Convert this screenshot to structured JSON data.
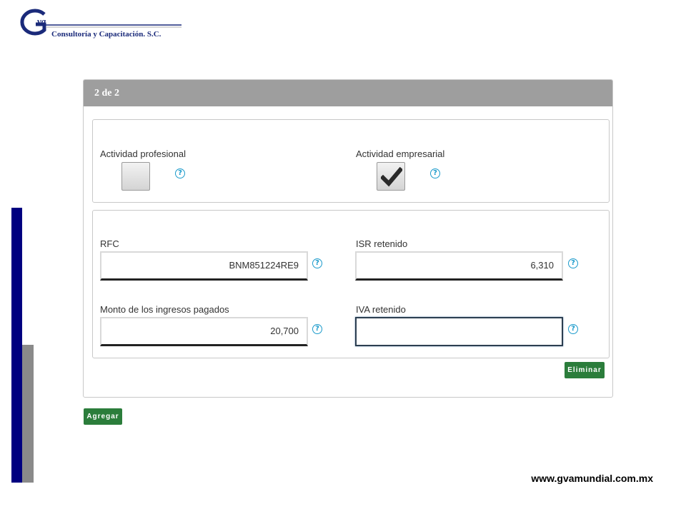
{
  "logo": {
    "monogram": "Gva",
    "company": "Consultoría y Capacitación. S.C."
  },
  "panel": {
    "title": "2 de 2"
  },
  "activity": {
    "profesional": {
      "label": "Actividad profesional",
      "checked": false
    },
    "empresarial": {
      "label": "Actividad empresarial",
      "checked": true
    }
  },
  "fields": {
    "rfc": {
      "label": "RFC",
      "value": "BNM851224RE9"
    },
    "isr": {
      "label": "ISR retenido",
      "value": "6,310"
    },
    "monto": {
      "label": "Monto de los ingresos pagados",
      "value": "20,700"
    },
    "iva": {
      "label": "IVA retenido",
      "value": ""
    }
  },
  "help_glyph": "?",
  "buttons": {
    "eliminar": "Eliminar",
    "agregar": "Agregar"
  },
  "footer": {
    "url": "www.gvamundial.com.mx"
  },
  "colors": {
    "header_gray": "#9e9e9e",
    "button_green": "#2b7d3b",
    "help_blue": "#1a9acb",
    "sidebar_blue": "#000080"
  }
}
